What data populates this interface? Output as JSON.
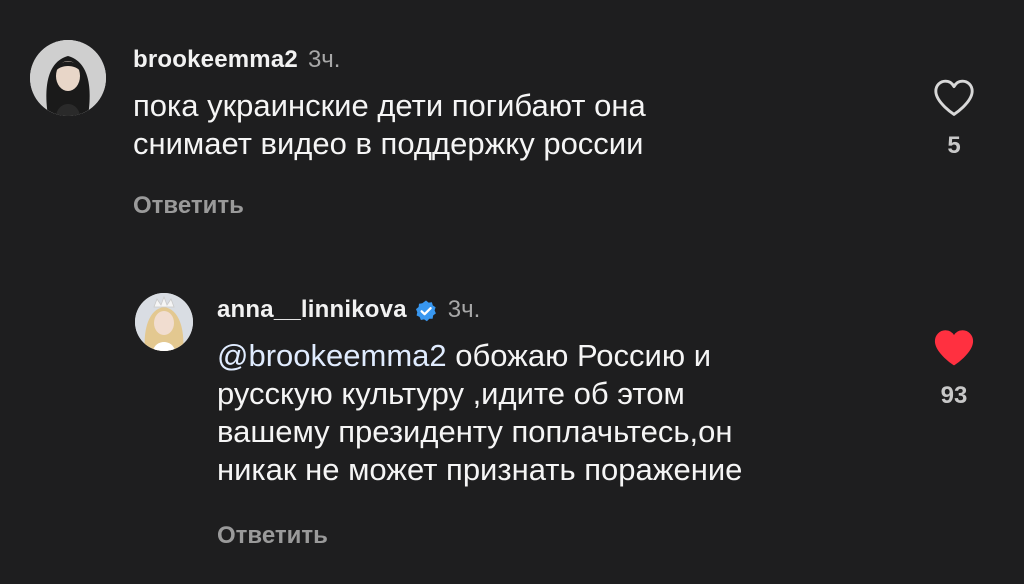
{
  "comments": [
    {
      "username": "brookeemma2",
      "time": "3ч.",
      "text_lines": [
        "пока украинские дети погибают она",
        "снимает видео в поддержку россии"
      ],
      "reply_label": "Ответить",
      "likes": "5",
      "liked": false,
      "avatar_icon": "user-avatar-dark-hair"
    },
    {
      "username": "anna__linnikova",
      "verified": true,
      "time": "3ч.",
      "mention": "@brookeemma2",
      "first_line_rest": " обожаю Россию и",
      "text_lines": [
        "русскую культуру ,идите об этом",
        "вашему президенту поплачьтесь,он",
        "никак не может признать поражение"
      ],
      "reply_label": "Ответить",
      "likes": "93",
      "liked": true,
      "avatar_icon": "user-avatar-blonde-crown"
    }
  ],
  "colors": {
    "background": "#1e1e1f",
    "liked_heart": "#ff3040",
    "verified_badge": "#3897f0",
    "muted_text": "#9a9a9a"
  }
}
